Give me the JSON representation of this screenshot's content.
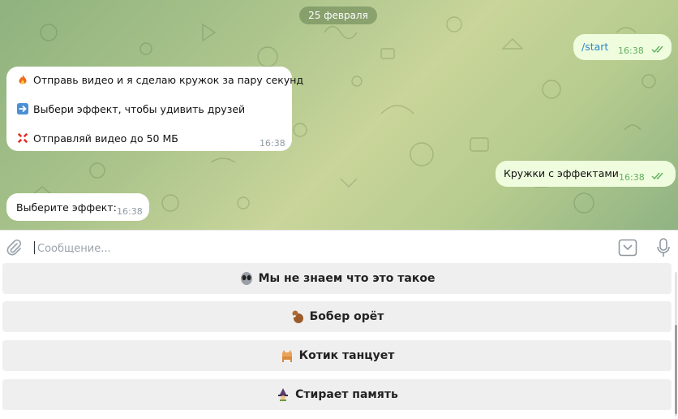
{
  "chat": {
    "date": "25 февраля",
    "messages": [
      {
        "side": "out",
        "text": "/start",
        "time": "16:38"
      },
      {
        "side": "in",
        "lines": [
          "Отправь видео и я сделаю кружок за пару секунд",
          "Выбери эффект, чтобы удивить друзей",
          "Отправляй видео до 50 МБ"
        ],
        "line_icons": [
          "fire-icon",
          "right-arrow-icon",
          "anger-icon"
        ],
        "time": "16:38"
      },
      {
        "side": "out",
        "text": "Кружки с эффектами",
        "time": "16:38"
      },
      {
        "side": "in",
        "text": "Выберите эффект:",
        "time": "16:38"
      }
    ]
  },
  "composer": {
    "placeholder": "Сообщение..."
  },
  "keyboard": {
    "buttons": [
      {
        "label": "Мы не знаем что это такое",
        "icon": "alien-icon"
      },
      {
        "label": "Бобер орёт",
        "icon": "beaver-icon"
      },
      {
        "label": "Котик танцует",
        "icon": "cat-icon"
      },
      {
        "label": "Стирает память",
        "icon": "witch-icon"
      }
    ]
  },
  "colors": {
    "incoming_bubble": "#ffffff",
    "outgoing_bubble": "#effdde",
    "command_link": "#2a88c8",
    "read_ticks": "#5fb05e",
    "keyboard_button": "#efefef"
  }
}
